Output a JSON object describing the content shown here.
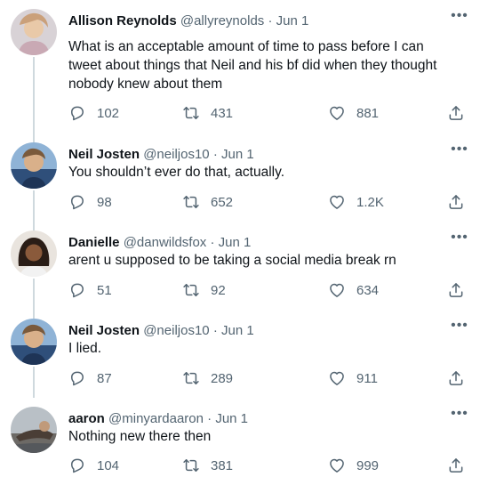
{
  "tweets": [
    {
      "name": "Allison Reynolds",
      "handle": "@allyreynolds",
      "sep": "·",
      "date": "Jun 1",
      "text": "What is an acceptable amount of time to pass before I can tweet about things that Neil and his bf did when they thought nobody knew about them",
      "replies": "102",
      "retweets": "431",
      "likes": "881"
    },
    {
      "name": "Neil Josten",
      "handle": "@neiljos10",
      "sep": "·",
      "date": "Jun 1",
      "text": "You shouldn’t ever do that, actually.",
      "replies": "98",
      "retweets": "652",
      "likes": "1.2K"
    },
    {
      "name": "Danielle",
      "handle": "@danwildsfox",
      "sep": "·",
      "date": "Jun 1",
      "text": "arent u supposed to be taking a social media break rn",
      "replies": "51",
      "retweets": "92",
      "likes": "634"
    },
    {
      "name": "Neil Josten",
      "handle": "@neiljos10",
      "sep": "·",
      "date": "Jun 1",
      "text": "I lied.",
      "replies": "87",
      "retweets": "289",
      "likes": "911"
    },
    {
      "name": "aaron",
      "handle": "@minyardaaron",
      "sep": "·",
      "date": "Jun 1",
      "text": "Nothing new there then",
      "replies": "104",
      "retweets": "381",
      "likes": "999"
    }
  ],
  "icons": {
    "more": "more-dots-icon",
    "reply": "reply-icon",
    "retweet": "retweet-icon",
    "like": "heart-icon",
    "share": "share-icon"
  },
  "colors": {
    "text": "#0f1419",
    "secondary": "#536471",
    "thread_line": "#cfd9de"
  }
}
